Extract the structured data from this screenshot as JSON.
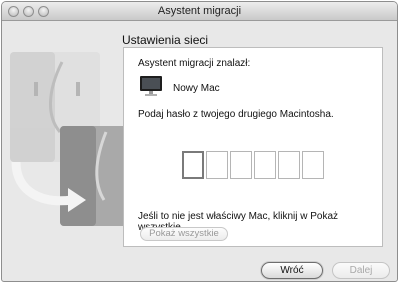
{
  "window": {
    "title": "Asystent migracji"
  },
  "section": {
    "title": "Ustawienia sieci"
  },
  "panel": {
    "found_label": "Asystent migracji znalazł:",
    "mac_name": "Nowy Mac",
    "prompt": "Podaj hasło z twojego drugiego Macintosha.",
    "code_boxes": [
      "",
      "",
      "",
      "",
      "",
      ""
    ],
    "note": "Jeśli to nie jest właściwy Mac, kliknij w Pokaż wszystkie.",
    "show_all_label": "Pokaż wszystkie"
  },
  "buttons": {
    "back_label": "Wróć",
    "next_label": "Dalej"
  },
  "icons": {
    "traffic_lights": [
      "close-icon",
      "minimize-icon",
      "zoom-icon"
    ],
    "computer": "imac-icon",
    "illustration": "finder-migration-icon"
  }
}
